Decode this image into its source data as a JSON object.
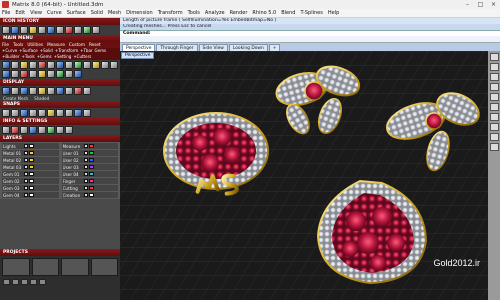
{
  "window": {
    "title": "Matrix 8.0 (64-bit) - Untitled.3dm",
    "controls": [
      "–",
      "□",
      "×"
    ]
  },
  "menubar": [
    "File",
    "Edit",
    "View",
    "Curve",
    "Surface",
    "Solid",
    "Mesh",
    "Dimension",
    "Transform",
    "Tools",
    "Analyze",
    "Render",
    "Rhino 5.0",
    "Blend",
    "T-Splines",
    "Help"
  ],
  "left": {
    "icon_history": "ICON HISTORY",
    "main_menu": "MAIN MENU",
    "main_tabs": [
      "File",
      "Tools",
      "Utilities",
      "Measure",
      "Custom",
      "Reset"
    ],
    "sub_tabs": [
      "+Curve",
      "+Surface",
      "+Solid",
      "+Transform",
      "+Tbar",
      "Gems"
    ],
    "sub_tabs2": [
      "+Builder",
      "+Tools",
      "+Gems",
      "+Setting",
      "+Cutters"
    ],
    "display": "DISPLAY",
    "display_labels": [
      "Create Mesh",
      "Shaded"
    ],
    "snaps": "SNAPS",
    "info_settings": "INFO & SETTINGS",
    "layers_title": "LAYERS",
    "layers": [
      {
        "name": "Lights",
        "color": "#ffffff"
      },
      {
        "name": "Measure",
        "color": "#ff3030"
      },
      {
        "name": "Metal 01",
        "color": "#ffd020"
      },
      {
        "name": "User 01",
        "color": "#30c030"
      },
      {
        "name": "Metal 02",
        "color": "#ffd020"
      },
      {
        "name": "User 02",
        "color": "#3060ff"
      },
      {
        "name": "Metal 03",
        "color": "#ffd020"
      },
      {
        "name": "User 03",
        "color": "#a040ff"
      },
      {
        "name": "Gem 01",
        "color": "#ffffff"
      },
      {
        "name": "User 04",
        "color": "#30c0c0"
      },
      {
        "name": "Gem 02",
        "color": "#ffffff"
      },
      {
        "name": "Finger",
        "color": "#ff30a0"
      },
      {
        "name": "Gem 03",
        "color": "#ffffff"
      },
      {
        "name": "Cutting",
        "color": "#ff3030"
      },
      {
        "name": "Gem 04",
        "color": "#ffffff"
      },
      {
        "name": "Creation",
        "color": "#ffffff"
      }
    ],
    "projects": "PROJECTS"
  },
  "command": {
    "line1": "Length of picture frame ( SelfIllumination=Yes  EmbedBitmap=No )",
    "line2": "Creating meshes... Press Esc to cancel",
    "prompt": "Command:"
  },
  "viewport": {
    "tabs": [
      "Perspective",
      "Through Finger",
      "Side View",
      "Looking Down",
      "+"
    ],
    "label": "Perspective",
    "watermark": "Gold2012.ir"
  }
}
